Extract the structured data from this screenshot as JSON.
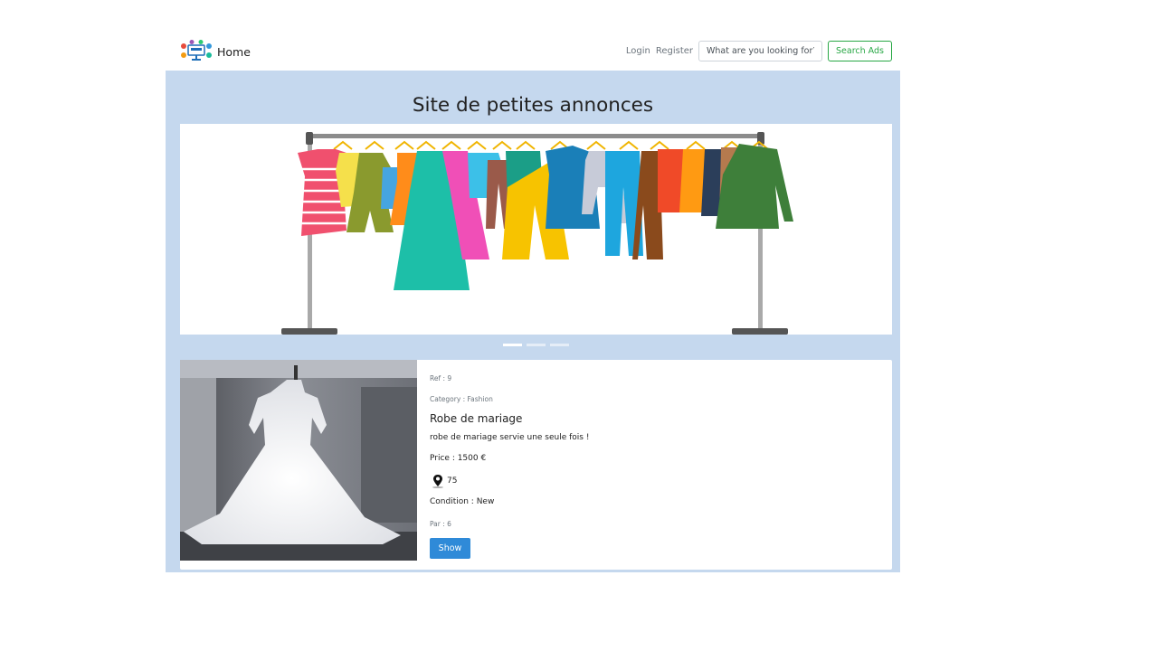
{
  "navbar": {
    "brand_text": "Home",
    "logo_icon": "monitor-logo-icon",
    "login_label": "Login",
    "register_label": "Register",
    "search_placeholder": "What are you looking for?",
    "search_button_label": "Search Ads"
  },
  "hero": {
    "title": "Site de petites annonces",
    "carousel_image": "clothes-rack-illustration",
    "slides_count": 3,
    "active_slide": 1
  },
  "ad": {
    "image": "wedding-dress-photo",
    "ref_label": "Ref : 9",
    "category_label": "Category : Fashion",
    "title": "Robe de mariage",
    "description": "robe de mariage servie une seule fois !",
    "price_label": "Price : 1500 €",
    "location_icon": "map-pin-icon",
    "location": "75",
    "condition_label": "Condition : New",
    "author_label": "Par : 6",
    "show_button_label": "Show"
  },
  "colors": {
    "panel_background": "#c5d8ee",
    "search_button": "#28a745",
    "show_button": "#2f8ad8"
  }
}
